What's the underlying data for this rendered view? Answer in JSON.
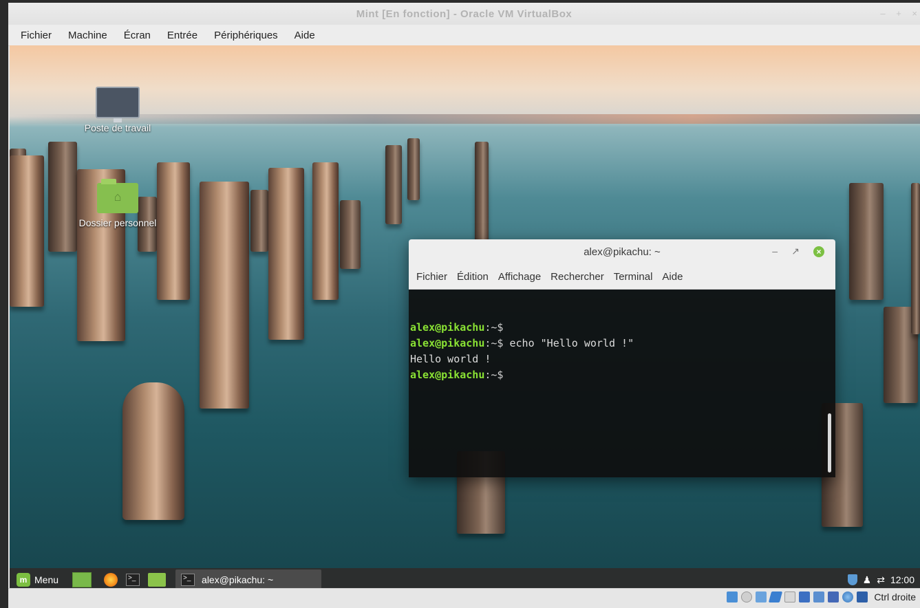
{
  "vbox": {
    "title": "Mint [En fonction] - Oracle VM VirtualBox",
    "controls": [
      "–",
      "+",
      "×"
    ],
    "menu": [
      "Fichier",
      "Machine",
      "Écran",
      "Entrée",
      "Périphériques",
      "Aide"
    ],
    "status_host_key": "Ctrl droite"
  },
  "desktop": {
    "icons": [
      "Poste de travail",
      "Dossier personnel"
    ]
  },
  "terminal": {
    "title": "alex@pikachu: ~",
    "menu": [
      "Fichier",
      "Édition",
      "Affichage",
      "Rechercher",
      "Terminal",
      "Aide"
    ],
    "lines": [
      {
        "user": "alex@pikachu",
        "path": ":~$",
        "cmd": ""
      },
      {
        "user": "alex@pikachu",
        "path": ":~$",
        "cmd": " echo \"Hello world !\""
      },
      {
        "output": "Hello world !"
      },
      {
        "user": "alex@pikachu",
        "path": ":~$",
        "cmd": ""
      }
    ]
  },
  "panel": {
    "menu_label": "Menu",
    "task": "alex@pikachu: ~",
    "clock": "12:00"
  },
  "colors": {
    "prompt": "#8ae234",
    "mint_green": "#7cbf41",
    "panel_bg": "#2d2d2d"
  }
}
